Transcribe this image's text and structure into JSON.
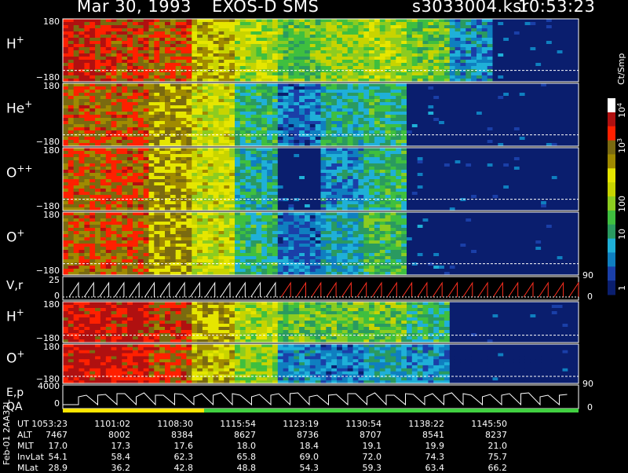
{
  "header": {
    "date": "Mar 30, 1993",
    "instrument": "EXOS-D SMS",
    "file": "s3033004.ksr",
    "time": "10:53:23"
  },
  "colors": {
    "background": "#000000",
    "scale": [
      "#0a1e6e",
      "#1a3fa8",
      "#0f7fc0",
      "#1fb0d8",
      "#2a9a60",
      "#3fbf3f",
      "#8ccc20",
      "#c8d400",
      "#e6e600",
      "#a08a00",
      "#7a6a10",
      "#ff2000",
      "#b01010",
      "#ffffff"
    ],
    "counter_line": "#ffffff",
    "sweep_white": "#ffffff",
    "sweep_red": "#ff3020",
    "qa_yellow": "#ffe600",
    "qa_green": "#40d040"
  },
  "chart_data": {
    "type": "heatmap",
    "x_axis": "UT",
    "panels": [
      {
        "id": "h-plus-1",
        "label": "H",
        "sup": "+",
        "ylim": [
          -180,
          180
        ],
        "tick_top": "180",
        "tick_bottom": "−180",
        "activity": [
          0.95,
          0.9,
          0.85,
          0.7,
          0.55,
          0.45,
          0.5,
          0.55,
          0.45,
          0.2,
          0.1,
          0.08
        ]
      },
      {
        "id": "he-plus",
        "label": "He",
        "sup": "+",
        "ylim": [
          -180,
          180
        ],
        "tick_top": "180",
        "tick_bottom": "−180",
        "activity": [
          0.85,
          0.85,
          0.75,
          0.6,
          0.35,
          0.15,
          0.3,
          0.35,
          0.1,
          0.05,
          0.05,
          0.05
        ]
      },
      {
        "id": "o-plus-plus",
        "label": "O",
        "sup": "++",
        "ylim": [
          -180,
          180
        ],
        "tick_top": "180",
        "tick_bottom": "−180",
        "activity": [
          0.85,
          0.85,
          0.75,
          0.6,
          0.3,
          0.1,
          0.2,
          0.35,
          0.1,
          0.05,
          0.05,
          0.05
        ]
      },
      {
        "id": "o-plus-1",
        "label": "O",
        "sup": "+",
        "ylim": [
          -180,
          180
        ],
        "tick_top": "180",
        "tick_bottom": "−180",
        "activity": [
          0.85,
          0.85,
          0.75,
          0.6,
          0.35,
          0.15,
          0.25,
          0.4,
          0.1,
          0.05,
          0.05,
          0.05
        ]
      },
      {
        "id": "h-plus-2",
        "label": "H",
        "sup": "+",
        "ylim": [
          -180,
          180
        ],
        "tick_top": "180",
        "tick_bottom": "−180",
        "activity": [
          0.98,
          0.98,
          0.9,
          0.75,
          0.55,
          0.45,
          0.45,
          0.45,
          0.35,
          0.05,
          0.05,
          0.05
        ]
      },
      {
        "id": "o-plus-2",
        "label": "O",
        "sup": "+",
        "ylim": [
          -180,
          180
        ],
        "tick_top": "180",
        "tick_bottom": "−180",
        "activity": [
          0.98,
          0.97,
          0.85,
          0.7,
          0.5,
          0.2,
          0.15,
          0.25,
          0.2,
          0.05,
          0.05,
          0.05
        ]
      }
    ],
    "vr_panel": {
      "label": "V,r",
      "tick_top": "25",
      "tick_bottom": "0",
      "right_top": "90",
      "right_bottom": "0"
    },
    "ep_panel": {
      "label": "E,p",
      "tick_top": "4000",
      "tick_bottom": "0",
      "right_top": "90",
      "right_bottom": "0"
    },
    "qa_label": "QA",
    "colorbar": {
      "unit": "Ct/Smp",
      "labels": [
        {
          "text": "10",
          "sup": "4",
          "value": 10000
        },
        {
          "text": "10",
          "sup": "3",
          "value": 1000
        },
        {
          "text": "100",
          "sup": "",
          "value": 100
        },
        {
          "text": "10",
          "sup": "",
          "value": 10
        },
        {
          "text": "1",
          "sup": "",
          "value": 1
        }
      ],
      "scale": "log"
    },
    "orbit_table": {
      "rows": [
        {
          "label": "UT",
          "values": [
            "1053:23",
            "1101:02",
            "1108:30",
            "1115:54",
            "1123:19",
            "1130:54",
            "1138:22",
            "1145:50"
          ]
        },
        {
          "label": "ALT",
          "values": [
            "7467",
            "8002",
            "8384",
            "8627",
            "8736",
            "8707",
            "8541",
            "8237"
          ]
        },
        {
          "label": "MLT",
          "values": [
            "17.0",
            "17.3",
            "17.6",
            "18.0",
            "18.4",
            "19.1",
            "19.9",
            "21.0"
          ]
        },
        {
          "label": "InvLat",
          "values": [
            "54.1",
            "58.4",
            "62.3",
            "65.8",
            "69.0",
            "72.0",
            "74.3",
            "75.7"
          ]
        },
        {
          "label": "MLat",
          "values": [
            "28.9",
            "36.2",
            "42.8",
            "48.8",
            "54.3",
            "59.3",
            "63.4",
            "66.2"
          ]
        }
      ]
    }
  },
  "side_label": "Feb-01 2AA32L"
}
